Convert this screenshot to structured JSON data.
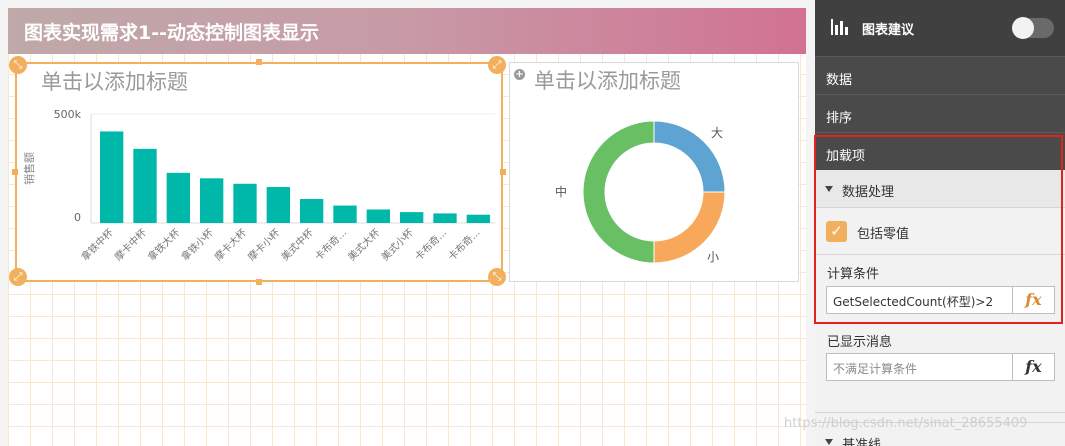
{
  "sheet": {
    "title": "图表实现需求1--动态控制图表显示"
  },
  "objects": [
    {
      "title": "单击以添加标题"
    },
    {
      "title": "单击以添加标题"
    }
  ],
  "chart_data": [
    {
      "type": "bar",
      "ylabel": "销售额",
      "yticks": [
        "500k",
        "0"
      ],
      "ylim": [
        0,
        500000
      ],
      "categories": [
        "拿铁中杯",
        "摩卡中杯",
        "拿铁大杯",
        "拿铁小杯",
        "摩卡大杯",
        "摩卡小杯",
        "美式中杯",
        "卡布奇...",
        "美式大杯",
        "美式小杯",
        "卡布奇...",
        "卡布奇..."
      ],
      "values": [
        420000,
        340000,
        230000,
        205000,
        180000,
        165000,
        110000,
        80000,
        62000,
        50000,
        44000,
        38000
      ],
      "color": "#00b8a9"
    },
    {
      "type": "pie",
      "donut": true,
      "labels": [
        "大",
        "小",
        "中"
      ],
      "values": [
        25,
        25,
        50
      ],
      "colors": [
        "#5ea4d2",
        "#f7a85a",
        "#69bf63"
      ]
    }
  ],
  "panel": {
    "title": "图表建议",
    "sections": {
      "data": "数据",
      "sort": "排序",
      "addons": "加载项",
      "data_handling": "数据处理",
      "include_zero": "包括零值",
      "calc_condition": "计算条件",
      "calc_condition_value": "GetSelectedCount(杯型)>2",
      "displayed_msg": "已显示消息",
      "displayed_msg_placeholder": "不满足计算条件",
      "fx": "fx",
      "ref_line": "基准线"
    }
  },
  "watermark": "https://blog.csdn.net/sinat_28655409",
  "colors": {
    "accent": "#f2b05f",
    "highlight": "#e2231a",
    "panel_dark": "#404040"
  }
}
